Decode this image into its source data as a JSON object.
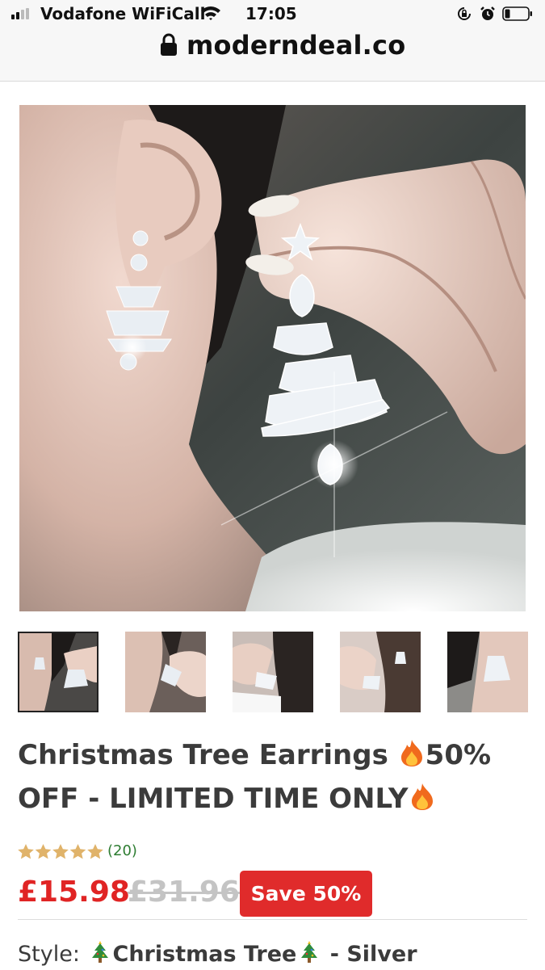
{
  "status_bar": {
    "carrier": "Vodafone WiFiCall",
    "time": "17:05",
    "icons": [
      "signal-icon",
      "wifi-icon",
      "rotation-lock-icon",
      "alarm-icon",
      "battery-icon"
    ]
  },
  "browser": {
    "domain": "moderndeal.co",
    "secure_icon": "lock-icon"
  },
  "product": {
    "image_count": 5,
    "selected_image": 1,
    "title_part1": "Christmas Tree Earrings ",
    "title_part2": "50% OFF - LIMITED TIME ONLY",
    "title_emoji": "fire-icon",
    "rating_stars": 5,
    "review_count": "(20)",
    "price": "£15.98",
    "compare_price": "£31.96",
    "save_badge": "Save 50%",
    "style_label": "Style:",
    "style_value_main": "Christmas Tree",
    "style_value_suffix": " - Silver"
  },
  "colors": {
    "price": "#e02424",
    "save_badge_bg": "#e02b2b",
    "compare_price": "#c4c4c4",
    "review_count": "#2e7d32",
    "stars": "#e0b36a"
  }
}
